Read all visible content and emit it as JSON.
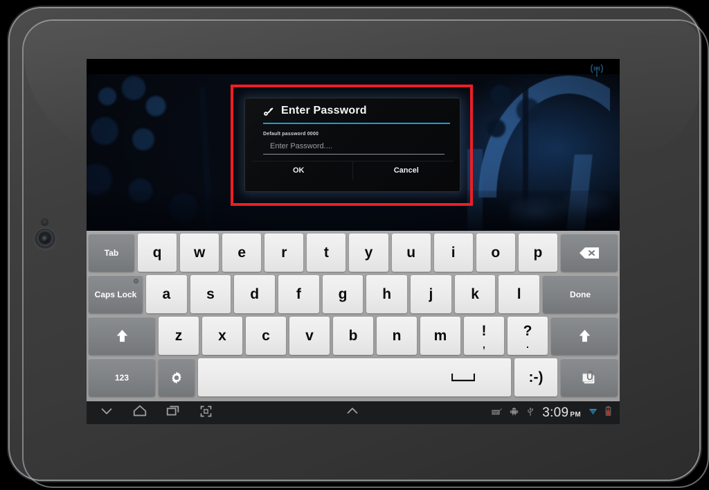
{
  "device": {
    "name": "android-tablet",
    "orientation": "landscape"
  },
  "statusbar": {
    "wifi_antenna_icon": "wifi-broadcast-icon"
  },
  "dialog": {
    "icon": "key-icon",
    "title": "Enter Password",
    "hint": "Default password 0000",
    "input": {
      "value": "",
      "placeholder": "Enter Password...."
    },
    "buttons": {
      "ok": "OK",
      "cancel": "Cancel"
    },
    "accent_color": "#1e9ad6"
  },
  "highlight": {
    "color": "#ee1d26",
    "label": "annotation-rectangle"
  },
  "keyboard": {
    "rows": [
      [
        {
          "label": "Tab",
          "type": "mod",
          "name": "key-tab",
          "width": "w-tab"
        },
        {
          "label": "q",
          "type": "char",
          "name": "key-q"
        },
        {
          "label": "w",
          "type": "char",
          "name": "key-w"
        },
        {
          "label": "e",
          "type": "char",
          "name": "key-e"
        },
        {
          "label": "r",
          "type": "char",
          "name": "key-r"
        },
        {
          "label": "t",
          "type": "char",
          "name": "key-t"
        },
        {
          "label": "y",
          "type": "char",
          "name": "key-y"
        },
        {
          "label": "u",
          "type": "char",
          "name": "key-u"
        },
        {
          "label": "i",
          "type": "char",
          "name": "key-i"
        },
        {
          "label": "o",
          "type": "char",
          "name": "key-o"
        },
        {
          "label": "p",
          "type": "char",
          "name": "key-p"
        },
        {
          "label": "",
          "type": "icon",
          "icon": "backspace-icon",
          "name": "key-backspace",
          "width": "w-bksp"
        }
      ],
      [
        {
          "label": "Caps Lock",
          "type": "mod",
          "name": "key-caps-lock",
          "width": "w-caps",
          "led": true
        },
        {
          "label": "a",
          "type": "char",
          "name": "key-a"
        },
        {
          "label": "s",
          "type": "char",
          "name": "key-s"
        },
        {
          "label": "d",
          "type": "char",
          "name": "key-d"
        },
        {
          "label": "f",
          "type": "char",
          "name": "key-f"
        },
        {
          "label": "g",
          "type": "char",
          "name": "key-g"
        },
        {
          "label": "h",
          "type": "char",
          "name": "key-h"
        },
        {
          "label": "j",
          "type": "char",
          "name": "key-j"
        },
        {
          "label": "k",
          "type": "char",
          "name": "key-k"
        },
        {
          "label": "l",
          "type": "char",
          "name": "key-l"
        },
        {
          "label": "Done",
          "type": "mod",
          "name": "key-done",
          "width": "w-done"
        }
      ],
      [
        {
          "label": "",
          "type": "icon",
          "icon": "shift-arrow-icon",
          "name": "key-shift-left",
          "width": "w-shift"
        },
        {
          "label": "z",
          "type": "char",
          "name": "key-z"
        },
        {
          "label": "x",
          "type": "char",
          "name": "key-x"
        },
        {
          "label": "c",
          "type": "char",
          "name": "key-c"
        },
        {
          "label": "v",
          "type": "char",
          "name": "key-v"
        },
        {
          "label": "b",
          "type": "char",
          "name": "key-b"
        },
        {
          "label": "n",
          "type": "char",
          "name": "key-n"
        },
        {
          "label": "m",
          "type": "char",
          "name": "key-m"
        },
        {
          "label": "!",
          "sub": ",",
          "type": "char",
          "name": "key-exclamation-comma"
        },
        {
          "label": "?",
          "sub": ".",
          "type": "char",
          "name": "key-question-period"
        },
        {
          "label": "",
          "type": "icon",
          "icon": "shift-arrow-icon",
          "name": "key-shift-right",
          "width": "w-shift-r"
        }
      ],
      [
        {
          "label": "123",
          "type": "mod",
          "name": "key-numbers",
          "width": "w-123"
        },
        {
          "label": "",
          "type": "icon",
          "icon": "gear-icon",
          "name": "key-settings",
          "width": "w-gear"
        },
        {
          "label": "",
          "type": "icon",
          "icon": "space-icon",
          "name": "key-space",
          "width": "w-space"
        },
        {
          "label": ":-)",
          "type": "char",
          "name": "key-emoticon",
          "width": "w-emoji"
        },
        {
          "label": "",
          "type": "icon",
          "icon": "attachment-icon",
          "name": "key-attachment",
          "width": "w-attach"
        }
      ]
    ]
  },
  "navbar": {
    "back_icon": "chevron-down-icon",
    "home_icon": "home-icon",
    "recents_icon": "recent-apps-icon",
    "fullscreen_icon": "fullscreen-icon",
    "expand_icon": "chevron-up-icon",
    "keyboard_icon": "keyboard-status-icon",
    "android_icon": "android-debug-icon",
    "usb_icon": "usb-icon",
    "clock_time": "3:09",
    "clock_ampm": "PM",
    "wifi_icon": "wifi-signal-icon",
    "battery_icon": "battery-low-icon",
    "wifi_color": "#2d9cdb",
    "battery_color": "#e03b2f"
  }
}
